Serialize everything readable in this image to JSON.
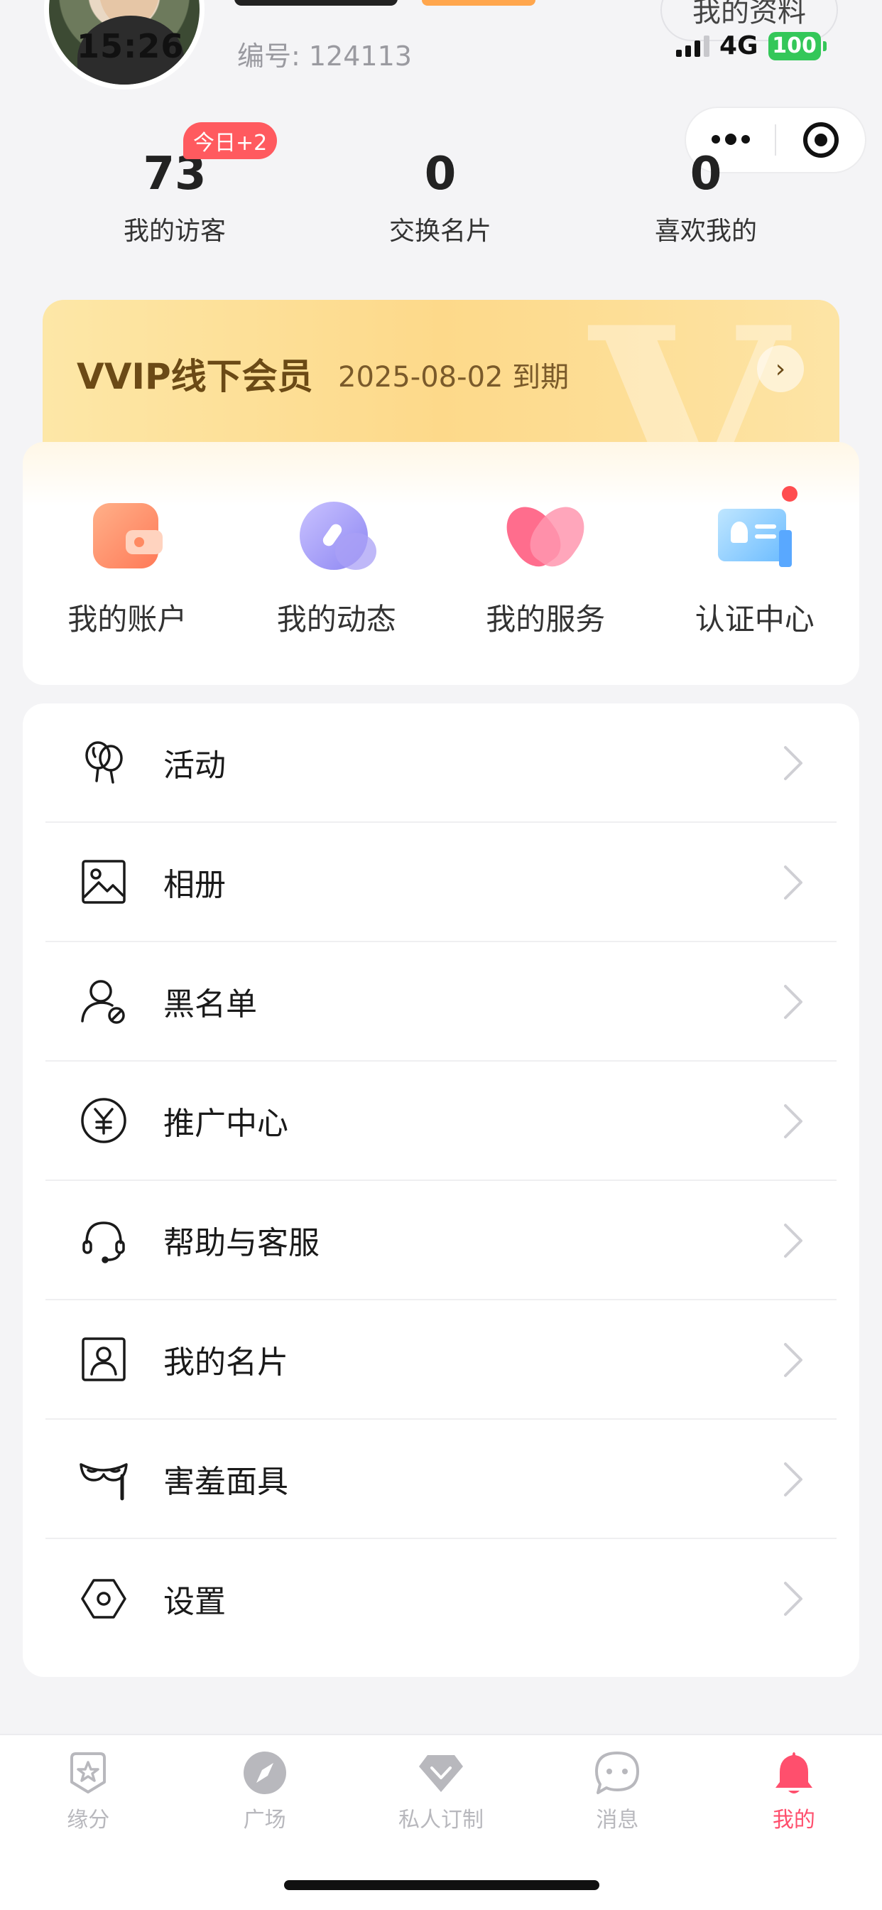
{
  "header": {
    "time": "15:26",
    "user_id": "编号: 124113",
    "profile_button": "我的资料",
    "network": "4G",
    "battery": "100"
  },
  "stats": [
    {
      "value": "73",
      "label": "我的访客"
    },
    {
      "value": "0",
      "label": "交换名片"
    },
    {
      "value": "0",
      "label": "喜欢我的"
    }
  ],
  "visitor_badge": "今日+2",
  "vip": {
    "title": "VVIP线下会员",
    "expire": "2025-08-02 到期"
  },
  "quick_entries": [
    {
      "label": "我的账户",
      "icon": "wallet-icon"
    },
    {
      "label": "我的动态",
      "icon": "compass-icon"
    },
    {
      "label": "我的服务",
      "icon": "heart-icon"
    },
    {
      "label": "认证中心",
      "icon": "certificate-icon"
    }
  ],
  "menu": [
    {
      "label": "活动",
      "icon": "balloon-icon"
    },
    {
      "label": "相册",
      "icon": "image-icon"
    },
    {
      "label": "黑名单",
      "icon": "user-block-icon"
    },
    {
      "label": "推广中心",
      "icon": "yen-icon"
    },
    {
      "label": "帮助与客服",
      "icon": "headset-icon"
    },
    {
      "label": "我的名片",
      "icon": "id-card-icon"
    },
    {
      "label": "害羞面具",
      "icon": "mask-icon"
    },
    {
      "label": "设置",
      "icon": "hexagon-settings-icon"
    }
  ],
  "tabbar": [
    {
      "label": "缘分",
      "icon": "star-badge-icon"
    },
    {
      "label": "广场",
      "icon": "compass-icon"
    },
    {
      "label": "私人订制",
      "icon": "diamond-icon"
    },
    {
      "label": "消息",
      "icon": "chat-icon"
    },
    {
      "label": "我的",
      "icon": "bell-icon",
      "active": true
    }
  ],
  "colors": {
    "accent": "#ff4f6d",
    "badge": "#ff5a5f",
    "vip_text": "#6b4a16",
    "battery": "#34c759"
  }
}
